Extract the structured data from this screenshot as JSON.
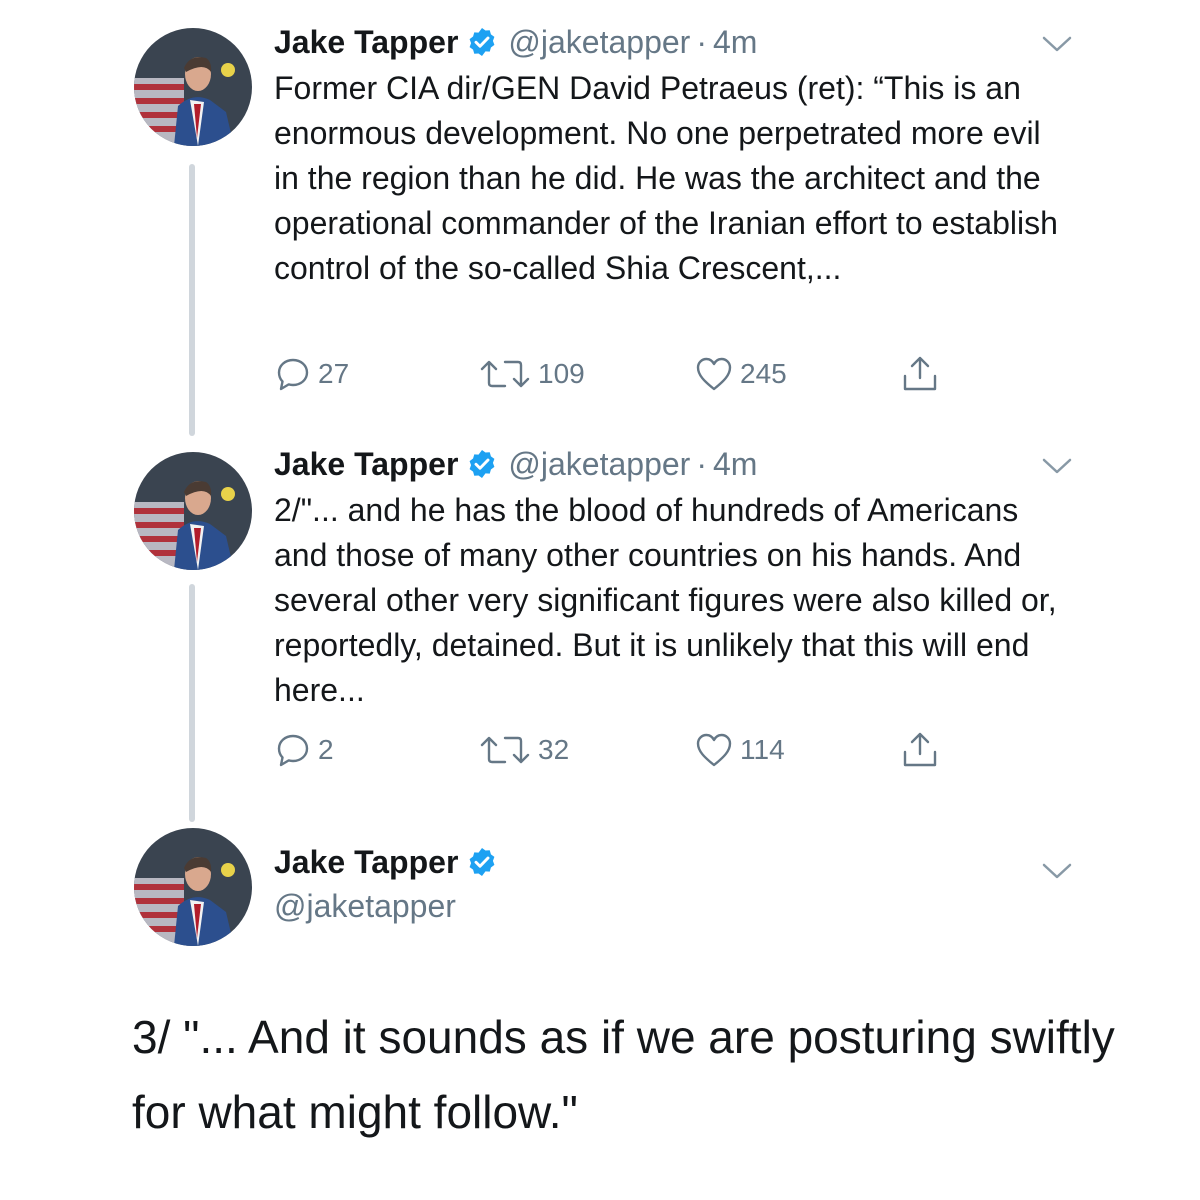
{
  "colors": {
    "verified": "#1da1f2",
    "thread_line": "#d0d6dc",
    "secondary_text": "#657786",
    "primary_text": "#14171a"
  },
  "tweets": [
    {
      "author_name": "Jake Tapper",
      "handle": "@jaketapper",
      "separator": "·",
      "time": "4m",
      "text": "Former CIA dir/GEN David Petraeus (ret):  “This is an enormous development. No one perpetrated more evil in the region than he did. He was the architect and the operational commander of the Iranian effort to establish control of the so-called Shia Crescent,...",
      "replies": "27",
      "retweets": "109",
      "likes": "245"
    },
    {
      "author_name": "Jake Tapper",
      "handle": "@jaketapper",
      "separator": "·",
      "time": "4m",
      "text": "2/\"... and he has the blood of hundreds of Americans and those of many other countries on his hands. And several other very significant figures were also killed or, reportedly, detained. But it is unlikely that this will end here...",
      "replies": "2",
      "retweets": "32",
      "likes": "114"
    },
    {
      "author_name": "Jake Tapper",
      "handle": "@jaketapper",
      "text": "3/ \"... And it sounds as if we are posturing swiftly for what might follow.\""
    }
  ],
  "icons": {
    "verified": "verified-badge-icon",
    "menu": "chevron-down-icon",
    "reply": "reply-bubble-icon",
    "retweet": "retweet-icon",
    "like": "heart-icon",
    "share": "share-upload-icon"
  }
}
